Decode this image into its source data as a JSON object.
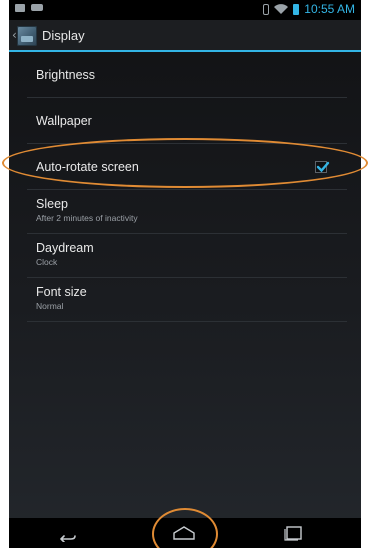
{
  "status_bar": {
    "time": "10:55 AM",
    "left_icons": [
      "notification-icon",
      "usb-icon"
    ],
    "right_icons": [
      "bluetooth-icon",
      "wifi-icon",
      "battery-icon"
    ],
    "accent_color": "#33b5e5"
  },
  "action_bar": {
    "title": "Display",
    "icon": "display-settings-icon",
    "up_icon": "back-caret-icon"
  },
  "settings": [
    {
      "title": "Brightness",
      "summary": ""
    },
    {
      "title": "Wallpaper",
      "summary": ""
    },
    {
      "title": "Auto-rotate screen",
      "summary": "",
      "checked": true
    },
    {
      "title": "Sleep",
      "summary": "After 2 minutes of inactivity"
    },
    {
      "title": "Daydream",
      "summary": "Clock"
    },
    {
      "title": "Font size",
      "summary": "Normal"
    }
  ],
  "nav_bar": {
    "buttons": [
      "back-icon",
      "home-icon",
      "recents-icon"
    ]
  },
  "annotations": {
    "color": "#e08b34",
    "highlighted": [
      "auto-rotate-row",
      "home-button"
    ]
  }
}
